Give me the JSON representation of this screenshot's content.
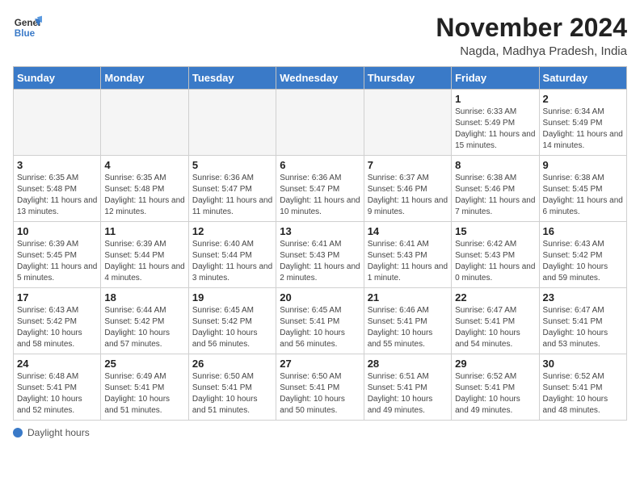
{
  "header": {
    "logo_line1": "General",
    "logo_line2": "Blue",
    "month_title": "November 2024",
    "location": "Nagda, Madhya Pradesh, India"
  },
  "weekdays": [
    "Sunday",
    "Monday",
    "Tuesday",
    "Wednesday",
    "Thursday",
    "Friday",
    "Saturday"
  ],
  "days": [
    {
      "date": "",
      "info": ""
    },
    {
      "date": "",
      "info": ""
    },
    {
      "date": "",
      "info": ""
    },
    {
      "date": "",
      "info": ""
    },
    {
      "date": "",
      "info": ""
    },
    {
      "date": "1",
      "info": "Sunrise: 6:33 AM\nSunset: 5:49 PM\nDaylight: 11 hours and 15 minutes."
    },
    {
      "date": "2",
      "info": "Sunrise: 6:34 AM\nSunset: 5:49 PM\nDaylight: 11 hours and 14 minutes."
    },
    {
      "date": "3",
      "info": "Sunrise: 6:35 AM\nSunset: 5:48 PM\nDaylight: 11 hours and 13 minutes."
    },
    {
      "date": "4",
      "info": "Sunrise: 6:35 AM\nSunset: 5:48 PM\nDaylight: 11 hours and 12 minutes."
    },
    {
      "date": "5",
      "info": "Sunrise: 6:36 AM\nSunset: 5:47 PM\nDaylight: 11 hours and 11 minutes."
    },
    {
      "date": "6",
      "info": "Sunrise: 6:36 AM\nSunset: 5:47 PM\nDaylight: 11 hours and 10 minutes."
    },
    {
      "date": "7",
      "info": "Sunrise: 6:37 AM\nSunset: 5:46 PM\nDaylight: 11 hours and 9 minutes."
    },
    {
      "date": "8",
      "info": "Sunrise: 6:38 AM\nSunset: 5:46 PM\nDaylight: 11 hours and 7 minutes."
    },
    {
      "date": "9",
      "info": "Sunrise: 6:38 AM\nSunset: 5:45 PM\nDaylight: 11 hours and 6 minutes."
    },
    {
      "date": "10",
      "info": "Sunrise: 6:39 AM\nSunset: 5:45 PM\nDaylight: 11 hours and 5 minutes."
    },
    {
      "date": "11",
      "info": "Sunrise: 6:39 AM\nSunset: 5:44 PM\nDaylight: 11 hours and 4 minutes."
    },
    {
      "date": "12",
      "info": "Sunrise: 6:40 AM\nSunset: 5:44 PM\nDaylight: 11 hours and 3 minutes."
    },
    {
      "date": "13",
      "info": "Sunrise: 6:41 AM\nSunset: 5:43 PM\nDaylight: 11 hours and 2 minutes."
    },
    {
      "date": "14",
      "info": "Sunrise: 6:41 AM\nSunset: 5:43 PM\nDaylight: 11 hours and 1 minute."
    },
    {
      "date": "15",
      "info": "Sunrise: 6:42 AM\nSunset: 5:43 PM\nDaylight: 11 hours and 0 minutes."
    },
    {
      "date": "16",
      "info": "Sunrise: 6:43 AM\nSunset: 5:42 PM\nDaylight: 10 hours and 59 minutes."
    },
    {
      "date": "17",
      "info": "Sunrise: 6:43 AM\nSunset: 5:42 PM\nDaylight: 10 hours and 58 minutes."
    },
    {
      "date": "18",
      "info": "Sunrise: 6:44 AM\nSunset: 5:42 PM\nDaylight: 10 hours and 57 minutes."
    },
    {
      "date": "19",
      "info": "Sunrise: 6:45 AM\nSunset: 5:42 PM\nDaylight: 10 hours and 56 minutes."
    },
    {
      "date": "20",
      "info": "Sunrise: 6:45 AM\nSunset: 5:41 PM\nDaylight: 10 hours and 56 minutes."
    },
    {
      "date": "21",
      "info": "Sunrise: 6:46 AM\nSunset: 5:41 PM\nDaylight: 10 hours and 55 minutes."
    },
    {
      "date": "22",
      "info": "Sunrise: 6:47 AM\nSunset: 5:41 PM\nDaylight: 10 hours and 54 minutes."
    },
    {
      "date": "23",
      "info": "Sunrise: 6:47 AM\nSunset: 5:41 PM\nDaylight: 10 hours and 53 minutes."
    },
    {
      "date": "24",
      "info": "Sunrise: 6:48 AM\nSunset: 5:41 PM\nDaylight: 10 hours and 52 minutes."
    },
    {
      "date": "25",
      "info": "Sunrise: 6:49 AM\nSunset: 5:41 PM\nDaylight: 10 hours and 51 minutes."
    },
    {
      "date": "26",
      "info": "Sunrise: 6:50 AM\nSunset: 5:41 PM\nDaylight: 10 hours and 51 minutes."
    },
    {
      "date": "27",
      "info": "Sunrise: 6:50 AM\nSunset: 5:41 PM\nDaylight: 10 hours and 50 minutes."
    },
    {
      "date": "28",
      "info": "Sunrise: 6:51 AM\nSunset: 5:41 PM\nDaylight: 10 hours and 49 minutes."
    },
    {
      "date": "29",
      "info": "Sunrise: 6:52 AM\nSunset: 5:41 PM\nDaylight: 10 hours and 49 minutes."
    },
    {
      "date": "30",
      "info": "Sunrise: 6:52 AM\nSunset: 5:41 PM\nDaylight: 10 hours and 48 minutes."
    }
  ],
  "footer": {
    "daylight_label": "Daylight hours"
  }
}
